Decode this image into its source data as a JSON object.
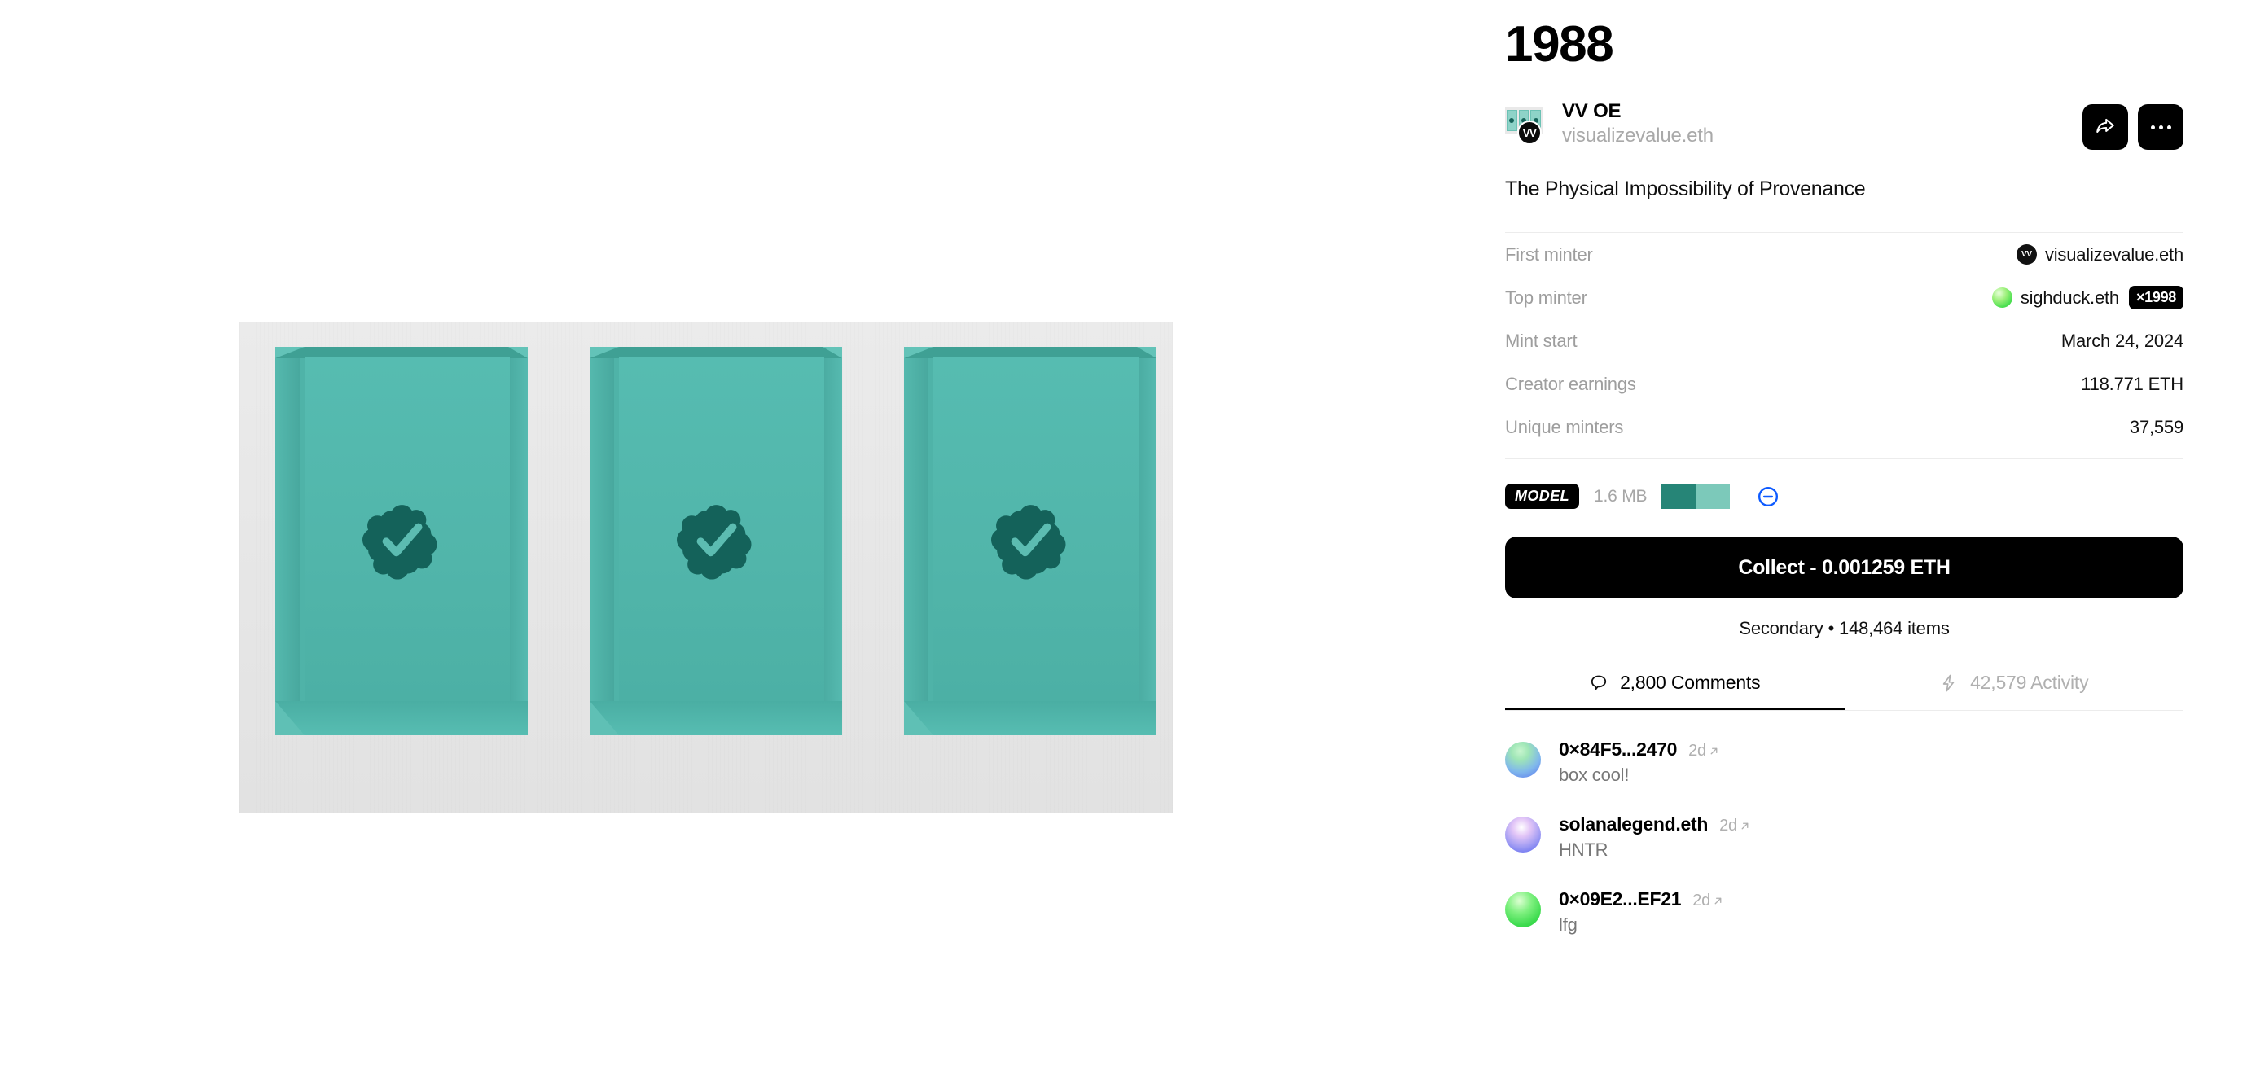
{
  "artwork": {
    "title_alt": "Three teal recessed boxes each containing a verified checkmark badge",
    "canvas_bg": "#e6e6e6",
    "box_color": "#4fb3a8",
    "badge_color": "#14625a",
    "box_count": 3
  },
  "token": {
    "title": "1988",
    "caption": "The Physical Impossibility of Provenance"
  },
  "creator": {
    "name": "VV OE",
    "ens": "visualizevalue.eth",
    "badge_initials": "VV"
  },
  "actions": {
    "share_icon": "share-icon",
    "more_icon": "ellipsis-icon"
  },
  "metadata": [
    {
      "key": "First minter",
      "value": "visualizevalue.eth",
      "avatar": "vv-dark",
      "avatar_initials": "VV"
    },
    {
      "key": "Top minter",
      "value": "sighduck.eth",
      "avatar": "green-sphere",
      "pill": "×1998"
    },
    {
      "key": "Mint start",
      "value": "March 24, 2024"
    },
    {
      "key": "Creator earnings",
      "value": "118.771 ETH"
    },
    {
      "key": "Unique minters",
      "value": "37,559"
    }
  ],
  "model": {
    "tag": "MODEL",
    "file_size": "1.6 MB",
    "swatch_dark": "#268577",
    "swatch_light": "#7cc9ba",
    "minus_icon_color": "#0d5aff"
  },
  "collect": {
    "label": "Collect - 0.001259 ETH",
    "secondary": "Secondary • 148,464 items"
  },
  "tabs": [
    {
      "label": "2,800 Comments",
      "icon": "comment-bubble-icon",
      "active": true
    },
    {
      "label": "42,579 Activity",
      "icon": "lightning-bolt-icon",
      "active": false
    }
  ],
  "comments": [
    {
      "user": "0×84F5...2470",
      "time": "2d",
      "text": "box cool!",
      "avatar": "c-av-1"
    },
    {
      "user": "solanalegend.eth",
      "time": "2d",
      "text": "HNTR",
      "avatar": "c-av-2"
    },
    {
      "user": "0×09E2...EF21",
      "time": "2d",
      "text": "lfg",
      "avatar": "c-av-3"
    }
  ]
}
